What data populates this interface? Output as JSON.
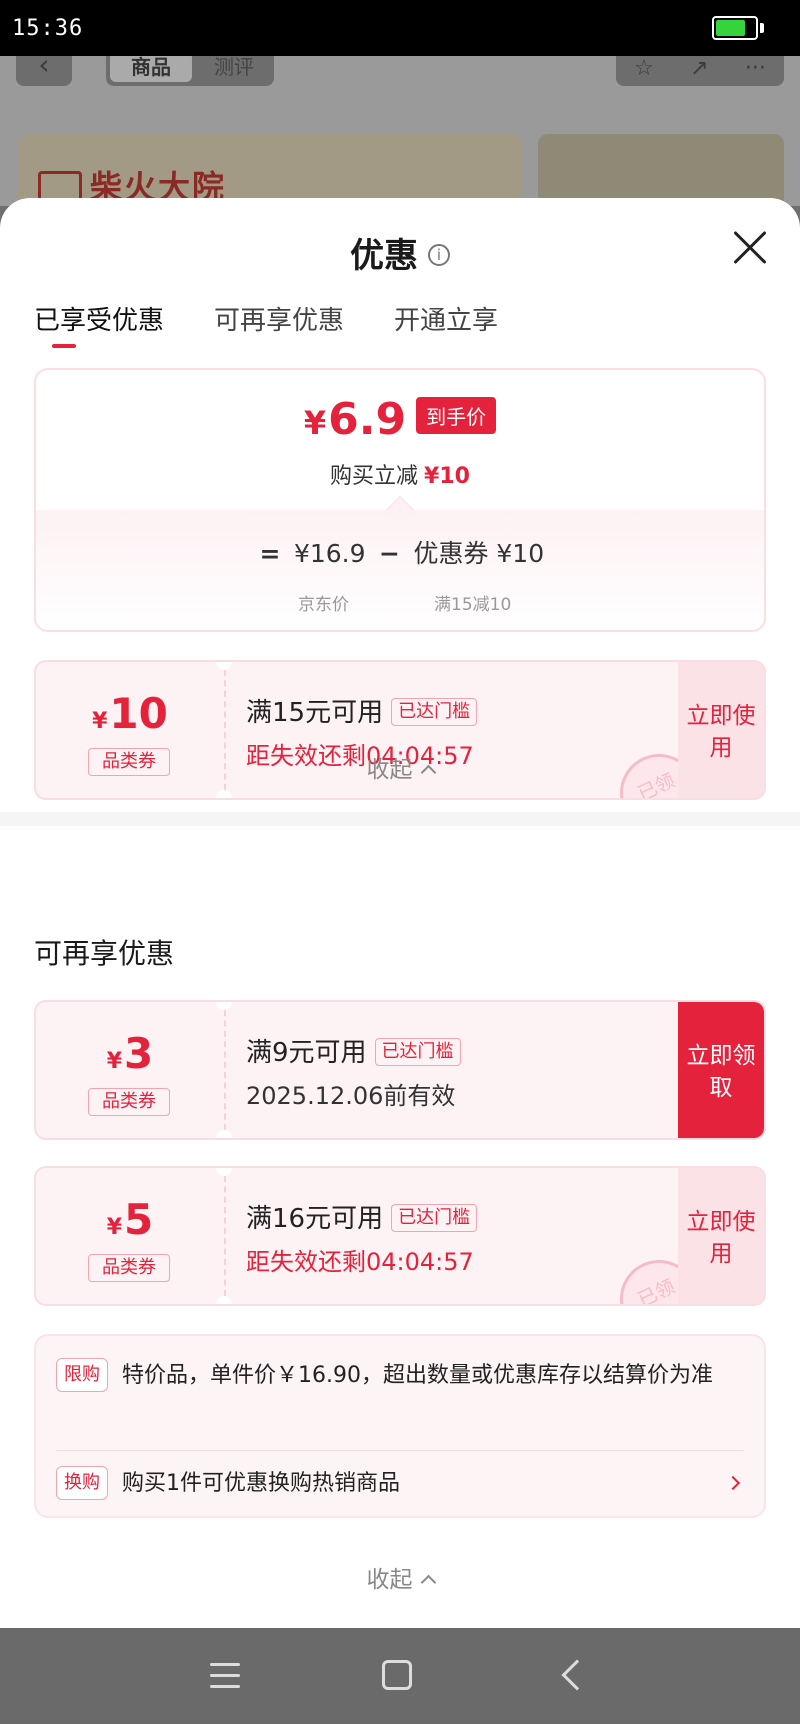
{
  "status_bar": {
    "time": "15:36",
    "battery_level": 0.75,
    "battery_color": "#35d43b"
  },
  "background": {
    "tab_goods": "商品",
    "tab_review": "测评",
    "store_logo": "柴火大院"
  },
  "sheet": {
    "title": "优惠",
    "tabs": [
      "已享受优惠",
      "可再享优惠",
      "开通立享"
    ],
    "price_card": {
      "final_yen": "¥",
      "final_price": "6.9",
      "final_tag": "到手价",
      "instant_label": "购买立减",
      "instant_amount": "¥10",
      "formula_eq": "=",
      "jd_price": "¥16.9",
      "formula_minus": "−",
      "coupon_part": "优惠券 ¥10",
      "jd_price_label": "京东价",
      "coupon_part_label": "满15减10"
    },
    "coupons_enjoyed": [
      {
        "yen": "¥",
        "amount": "10",
        "type": "品类券",
        "condition": "满15元可用",
        "reach": "已达门槛",
        "expire": "距失效还剩04:04:57",
        "action": "立即使用",
        "stamp": "已领"
      }
    ],
    "collapse_label": "收起",
    "section_more": "可再享优惠",
    "coupons_more": [
      {
        "yen": "¥",
        "amount": "3",
        "type": "品类券",
        "condition": "满9元可用",
        "reach": "已达门槛",
        "expire": "2025.12.06前有效",
        "action": "立即领取"
      },
      {
        "yen": "¥",
        "amount": "5",
        "type": "品类券",
        "condition": "满16元可用",
        "reach": "已达门槛",
        "expire": "距失效还剩04:04:57",
        "action": "立即使用",
        "stamp": "已领"
      }
    ],
    "notes": [
      {
        "badge": "限购",
        "text": "特价品，单件价￥16.90，超出数量或优惠库存以结算价为准"
      },
      {
        "badge": "换购",
        "text": "购买1件可优惠换购热销商品"
      }
    ],
    "collapse_label_2": "收起"
  },
  "colors": {
    "accent": "#e5223b",
    "coupon_bg": "#fdf2f4"
  }
}
